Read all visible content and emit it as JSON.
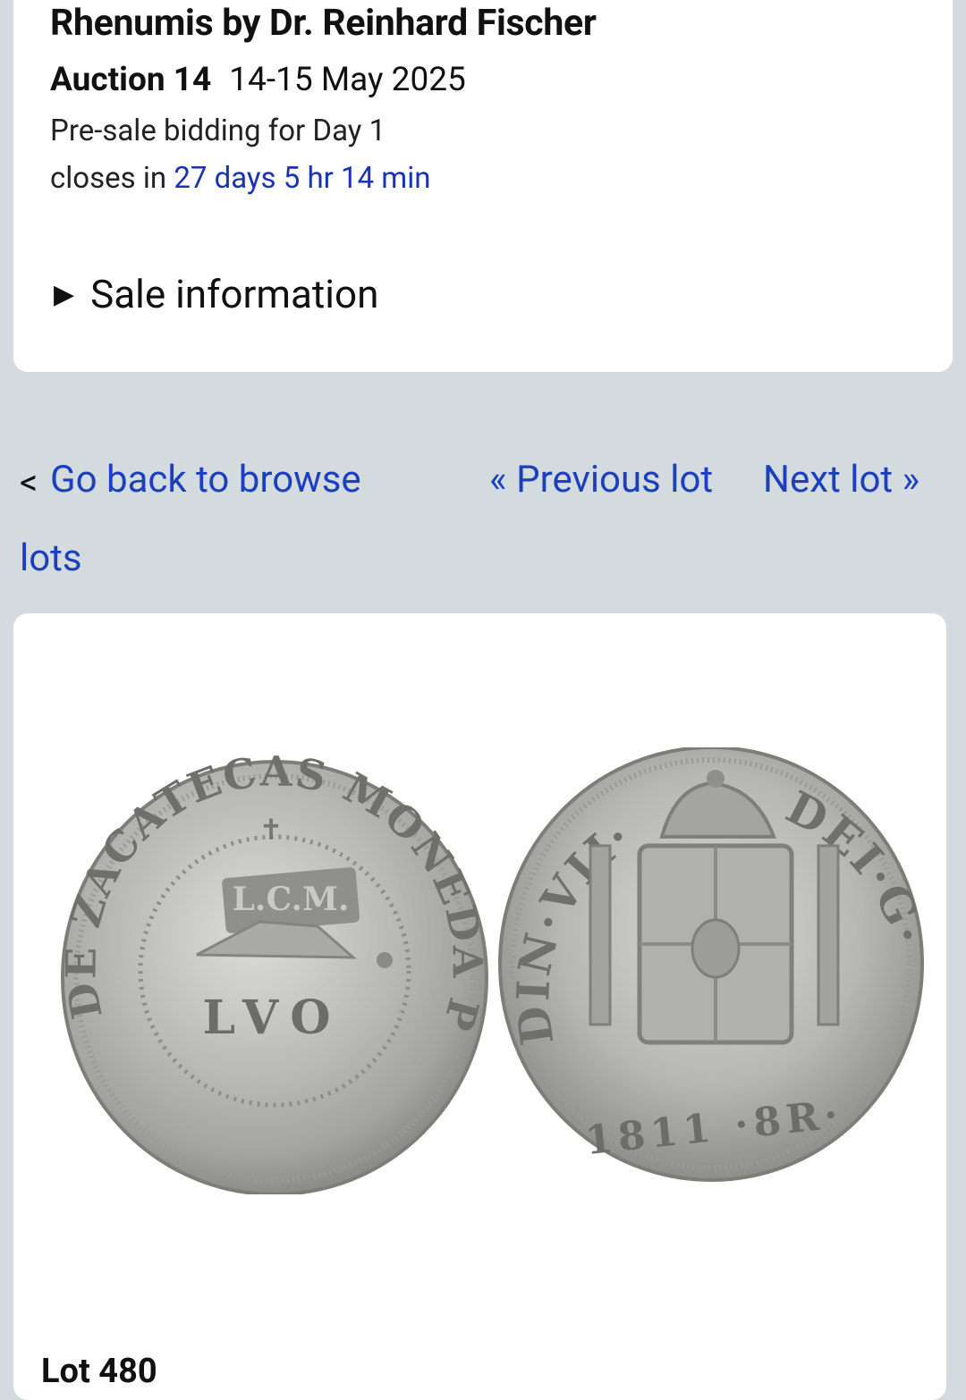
{
  "header": {
    "house": "Rhenumis by Dr. Reinhard Fischer",
    "auction_label": "Auction 14",
    "auction_dates": "14-15 May 2025",
    "presale_text": "Pre-sale bidding for Day 1",
    "closes_prefix": "closes in",
    "countdown": "27 days 5 hr 14 min",
    "sale_info_label": "Sale information"
  },
  "nav": {
    "back_prefix": "<",
    "back_label_line1": "Go back to browse",
    "back_label_line2": "lots",
    "prev_label": "« Previous lot",
    "next_label": "Next lot »"
  },
  "lot": {
    "title": "Lot 480",
    "obverse_legend": "DE ZACATECAS MONEDA PROVISIONAL",
    "obverse_center": "LVO",
    "countermark": "L.C.M.",
    "reverse_legend_left": "DIN·VII·",
    "reverse_legend_right": "DEI·G·",
    "reverse_bottom": "1811 ·8R·"
  },
  "colors": {
    "page_bg": "#d4dbdf",
    "card_bg": "#ffffff",
    "link": "#1c3fbf",
    "countdown": "#1a33b3"
  }
}
